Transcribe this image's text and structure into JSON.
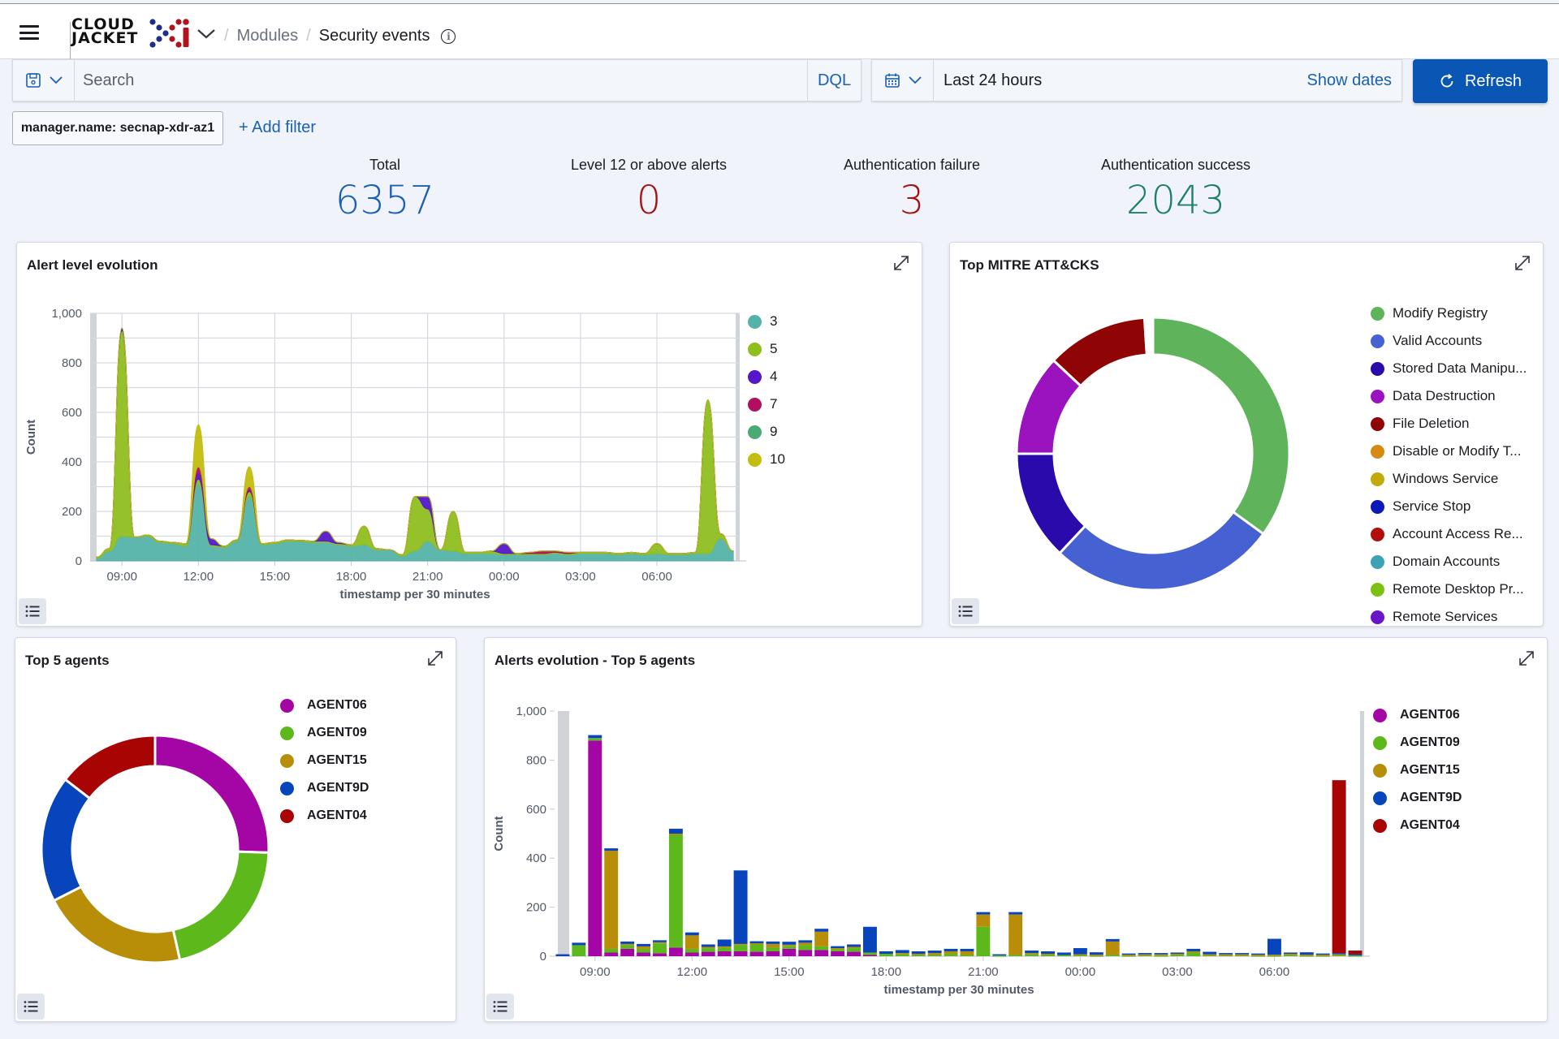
{
  "header": {
    "logo_text_line1": "CLOUD",
    "logo_text_line2": "JACKET",
    "breadcrumbs": [
      "Modules",
      "Security events"
    ]
  },
  "query_bar": {
    "search_placeholder": "Search",
    "search_value": "",
    "language_label": "DQL"
  },
  "date_picker": {
    "range_label": "Last 24 hours",
    "show_dates_label": "Show dates",
    "refresh_label": "Refresh"
  },
  "filters": {
    "active": [
      {
        "label": "manager.name: secnap-xdr-az1"
      }
    ],
    "add_label": "+ Add filter"
  },
  "metrics": [
    {
      "label": "Total",
      "value": "6357",
      "color": "#1b5fb4"
    },
    {
      "label": "Level 12 or above alerts",
      "value": "0",
      "color": "#a51010"
    },
    {
      "label": "Authentication failure",
      "value": "3",
      "color": "#a51010"
    },
    {
      "label": "Authentication success",
      "value": "2043",
      "color": "#1e7f6a"
    }
  ],
  "panels": {
    "alert_level": {
      "title": "Alert level evolution"
    },
    "mitre": {
      "title": "Top MITRE ATT&CKS"
    },
    "top_agents": {
      "title": "Top 5 agents"
    },
    "agents_evolution": {
      "title": "Alerts evolution - Top 5 agents"
    }
  },
  "icons": {
    "menu": "hamburger-icon",
    "save_query": "floppy-disk-icon",
    "calendar": "calendar-icon",
    "refresh": "refresh-icon",
    "expand": "expand-icon",
    "legend": "list-icon",
    "info": "info-icon"
  },
  "chart_data": [
    {
      "id": "alert_level",
      "type": "area",
      "stacked": true,
      "title": "Alert level evolution",
      "xlabel": "timestamp per 30 minutes",
      "ylabel": "Count",
      "ylim": [
        0,
        1000
      ],
      "yticks": [
        0,
        200,
        400,
        600,
        800,
        1000
      ],
      "ytick_labels": [
        "0",
        "200",
        "400",
        "600",
        "800",
        "1,000"
      ],
      "xtick_labels": [
        "09:00",
        "12:00",
        "15:00",
        "18:00",
        "21:00",
        "00:00",
        "03:00",
        "06:00"
      ],
      "x_start": "08:00",
      "interval_minutes": 30,
      "grid": true,
      "legend_position": "right",
      "series": [
        {
          "name": "3",
          "color": "#54b3a8",
          "values": [
            10,
            40,
            100,
            95,
            100,
            75,
            70,
            60,
            310,
            60,
            55,
            80,
            260,
            65,
            70,
            80,
            78,
            75,
            75,
            65,
            60,
            65,
            45,
            45,
            20,
            40,
            80,
            45,
            40,
            30,
            30,
            30,
            25,
            25,
            25,
            25,
            30,
            25,
            30,
            30,
            30,
            25,
            30,
            25,
            30,
            25,
            25,
            30,
            30,
            90,
            40
          ]
        },
        {
          "name": "5",
          "color": "#8fbf1f",
          "values": [
            5,
            10,
            830,
            0,
            5,
            5,
            5,
            10,
            20,
            5,
            5,
            5,
            20,
            5,
            5,
            5,
            5,
            5,
            5,
            5,
            5,
            75,
            5,
            0,
            5,
            220,
            130,
            0,
            160,
            5,
            5,
            10,
            5,
            5,
            5,
            5,
            5,
            5,
            5,
            5,
            5,
            5,
            5,
            5,
            40,
            5,
            5,
            5,
            620,
            20,
            0
          ]
        },
        {
          "name": "4",
          "color": "#5417c9",
          "values": [
            0,
            0,
            10,
            0,
            0,
            0,
            0,
            0,
            25,
            25,
            0,
            0,
            5,
            0,
            0,
            0,
            0,
            0,
            40,
            5,
            0,
            0,
            0,
            0,
            0,
            0,
            50,
            0,
            0,
            0,
            0,
            0,
            40,
            0,
            0,
            0,
            0,
            0,
            0,
            0,
            0,
            0,
            0,
            0,
            0,
            0,
            0,
            0,
            0,
            0,
            0
          ]
        },
        {
          "name": "7",
          "color": "#b0105f",
          "values": [
            0,
            0,
            0,
            0,
            0,
            0,
            0,
            0,
            25,
            0,
            0,
            0,
            15,
            0,
            0,
            0,
            0,
            0,
            0,
            0,
            0,
            0,
            0,
            0,
            0,
            0,
            0,
            0,
            0,
            0,
            0,
            0,
            0,
            0,
            5,
            10,
            5,
            5,
            0,
            0,
            0,
            0,
            0,
            0,
            0,
            0,
            0,
            0,
            0,
            0,
            0
          ]
        },
        {
          "name": "9",
          "color": "#4aaa74",
          "values": [
            0,
            0,
            0,
            0,
            0,
            0,
            0,
            0,
            0,
            0,
            0,
            0,
            0,
            0,
            0,
            0,
            0,
            0,
            0,
            0,
            0,
            0,
            0,
            0,
            0,
            0,
            0,
            0,
            0,
            0,
            0,
            0,
            0,
            0,
            0,
            0,
            0,
            0,
            0,
            0,
            0,
            0,
            0,
            0,
            0,
            0,
            0,
            0,
            0,
            0,
            0
          ]
        },
        {
          "name": "10",
          "color": "#c3bd10",
          "values": [
            0,
            0,
            0,
            0,
            0,
            0,
            0,
            0,
            170,
            0,
            0,
            0,
            80,
            0,
            0,
            0,
            0,
            0,
            0,
            0,
            0,
            0,
            0,
            0,
            0,
            0,
            0,
            0,
            0,
            0,
            0,
            0,
            0,
            0,
            0,
            0,
            0,
            0,
            0,
            0,
            0,
            0,
            0,
            0,
            0,
            0,
            0,
            0,
            0,
            0,
            0
          ]
        }
      ]
    },
    {
      "id": "mitre",
      "type": "pie",
      "donut": true,
      "title": "Top MITRE ATT&CKS",
      "legend_position": "right",
      "labels": [
        "Modify Registry",
        "Valid Accounts",
        "Stored Data Manipu...",
        "Data Destruction",
        "File Deletion",
        "Disable or Modify T...",
        "Windows Service",
        "Service Stop",
        "Account Access Re...",
        "Domain Accounts",
        "Remote Desktop Pr...",
        "Remote Services"
      ],
      "colors": [
        "#5fb35a",
        "#4561d2",
        "#2a0aaa",
        "#9b13be",
        "#8f0404",
        "#d68a14",
        "#c1aa0a",
        "#0b19b8",
        "#b10e0e",
        "#3ea2b5",
        "#7cc10f",
        "#6a16c8"
      ],
      "values": [
        35,
        27,
        13,
        12,
        12,
        0.3,
        0.2,
        0.2,
        0.1,
        0.1,
        0.05,
        0.05
      ]
    },
    {
      "id": "top_agents",
      "type": "pie",
      "donut": true,
      "title": "Top 5 agents",
      "legend_position": "right",
      "labels": [
        "AGENT06",
        "AGENT09",
        "AGENT15",
        "AGENT9D",
        "AGENT04"
      ],
      "colors": [
        "#a406a6",
        "#5db81b",
        "#b88e08",
        "#0844bc",
        "#a80404"
      ],
      "values": [
        25.5,
        21,
        21,
        18,
        14.5
      ]
    },
    {
      "id": "agents_evolution",
      "type": "bar",
      "stacked": true,
      "title": "Alerts evolution - Top 5 agents",
      "xlabel": "timestamp per 30 minutes",
      "ylabel": "Count",
      "ylim": [
        0,
        1000
      ],
      "yticks": [
        0,
        200,
        400,
        600,
        800,
        1000
      ],
      "ytick_labels": [
        "0",
        "200",
        "400",
        "600",
        "800",
        "1,000"
      ],
      "xtick_labels": [
        "09:00",
        "12:00",
        "15:00",
        "18:00",
        "21:00",
        "00:00",
        "03:00",
        "06:00"
      ],
      "x_start": "08:00",
      "interval_minutes": 30,
      "legend_position": "right",
      "series": [
        {
          "name": "AGENT06",
          "color": "#a406a6",
          "values": [
            0,
            0,
            880,
            15,
            30,
            15,
            12,
            35,
            15,
            18,
            20,
            20,
            18,
            20,
            30,
            25,
            25,
            20,
            18,
            5,
            0,
            0,
            0,
            0,
            0,
            0,
            0,
            0,
            0,
            0,
            0,
            0,
            0,
            0,
            0,
            0,
            0,
            0,
            0,
            0,
            0,
            0,
            0,
            0,
            0,
            0,
            0,
            0,
            0,
            0
          ]
        },
        {
          "name": "AGENT09",
          "color": "#5db81b",
          "values": [
            0,
            45,
            10,
            15,
            15,
            15,
            40,
            460,
            15,
            15,
            15,
            25,
            30,
            15,
            12,
            20,
            15,
            8,
            15,
            10,
            10,
            8,
            5,
            5,
            10,
            5,
            120,
            3,
            5,
            8,
            5,
            5,
            5,
            3,
            5,
            3,
            5,
            3,
            5,
            15,
            5,
            5,
            5,
            3,
            3,
            5,
            3,
            3,
            5,
            3
          ]
        },
        {
          "name": "AGENT15",
          "color": "#b88e08",
          "values": [
            0,
            0,
            0,
            400,
            5,
            10,
            5,
            5,
            55,
            5,
            5,
            5,
            5,
            15,
            5,
            10,
            60,
            5,
            5,
            0,
            0,
            5,
            5,
            8,
            10,
            15,
            50,
            0,
            165,
            5,
            5,
            0,
            3,
            3,
            55,
            3,
            3,
            5,
            5,
            5,
            3,
            3,
            3,
            3,
            3,
            5,
            3,
            3,
            3,
            0
          ]
        },
        {
          "name": "AGENT9D",
          "color": "#0844bc",
          "values": [
            8,
            10,
            12,
            10,
            10,
            10,
            8,
            20,
            12,
            10,
            28,
            300,
            8,
            10,
            12,
            10,
            12,
            8,
            10,
            105,
            10,
            12,
            10,
            10,
            10,
            10,
            10,
            5,
            10,
            10,
            10,
            10,
            25,
            10,
            10,
            5,
            5,
            5,
            5,
            10,
            10,
            5,
            5,
            5,
            65,
            5,
            10,
            5,
            5,
            5
          ]
        },
        {
          "name": "AGENT04",
          "color": "#a80404",
          "values": [
            0,
            0,
            0,
            0,
            0,
            0,
            0,
            0,
            0,
            0,
            0,
            0,
            0,
            0,
            0,
            0,
            0,
            0,
            0,
            0,
            0,
            0,
            0,
            0,
            0,
            0,
            0,
            0,
            0,
            0,
            0,
            0,
            0,
            0,
            0,
            0,
            0,
            0,
            0,
            0,
            0,
            0,
            0,
            0,
            0,
            0,
            0,
            0,
            705,
            15
          ]
        }
      ]
    }
  ]
}
